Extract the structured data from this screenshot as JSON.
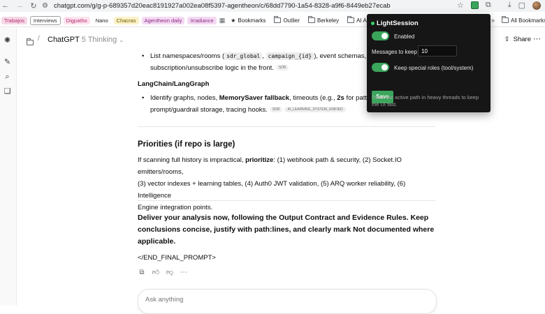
{
  "browser": {
    "url": "chatgpt.com/g/g-p-689357d20eac8191927a002ea08f5397-agentheon/c/68dd7790-1a54-8328-a9f6-8449eb27ecab"
  },
  "bookmarks": {
    "chips": [
      {
        "label": "Trabajos",
        "bg": "#f6d7e6",
        "color": "#b0306a"
      },
      {
        "label": "Interviews",
        "bg": "#ffffff",
        "color": "#333333",
        "border": "#9e9e9e"
      },
      {
        "label": "Digpatho",
        "bg": "#fde2ef",
        "color": "#b0306a"
      },
      {
        "label": "Nano",
        "bg": "transparent",
        "color": "#202124"
      },
      {
        "label": "Chacras",
        "bg": "#fcf2c7",
        "color": "#6b5a00"
      },
      {
        "label": "Agentheon daily",
        "bg": "#f3d9f2",
        "color": "#8e2b86"
      },
      {
        "label": "Irradiance",
        "bg": "#f3d9f2",
        "color": "#8e2b86"
      }
    ],
    "bookmarks_label": "Bookmarks",
    "folders": [
      "Outlier",
      "Berkeley",
      "AI AGents"
    ],
    "all_bookmarks": "All Bookmarks"
  },
  "header": {
    "model": "ChatGPT",
    "model_sub": "5 Thinking",
    "share_label": "Share"
  },
  "content": {
    "bullet1_a": "List namespaces/rooms (",
    "code1": "sdr_global",
    "code2": "campaign_{id}",
    "bullet1_b": "), event schemas, and",
    "bullet1_line2": "subscription/unsubscribe logic in the front.",
    "tag1": "SDR",
    "heading_lc": "LangChain/LangGraph",
    "bullet2_a": "Identify graphs, nodes, ",
    "bullet2_bold": "MemorySaver fallback",
    "bullet2_b": ", timeouts (e.g., ",
    "bullet2_bold2": "2s",
    "bullet2_c": " for pattern",
    "bullet2_line2": "prompt/guardrail storage, tracing hooks.",
    "tag2": "SDR",
    "tag3": "AI_LEARNING_SYSTEM_UNIFIED",
    "priorities_title": "Priorities (if repo is large)",
    "prio_a": "If scanning full history is impractical, ",
    "prio_bold": "prioritize",
    "prio_b": ": (1) webhook path & security, (2) Socket.IO emitters/rooms,",
    "prio_line2": "(3) vector indexes + learning tables, (4) Auth0 JWT validation, (5) ARQ worker reliability, (6) Intelligence",
    "prio_line3": "Engine integration points.",
    "deliver_line1": "Deliver your analysis now, following the Output Contract and Evidence Rules. Keep",
    "deliver_line2": "conclusions concise, justify with path:lines, and clearly mark Not documented where",
    "deliver_line3": "applicable.",
    "end_tag": "</END_FINAL_PROMPT>"
  },
  "composer": {
    "placeholder": "Ask anything"
  },
  "popup": {
    "title": "LightSession",
    "enabled_label": "Enabled",
    "enabled": true,
    "messages_label": "Messages to keep",
    "messages_value": "10",
    "special_label": "Keep special roles (tool/system)",
    "special": true,
    "save_label": "Save",
    "note": "Trims the active path in heavy threads to keep the UI fast."
  }
}
